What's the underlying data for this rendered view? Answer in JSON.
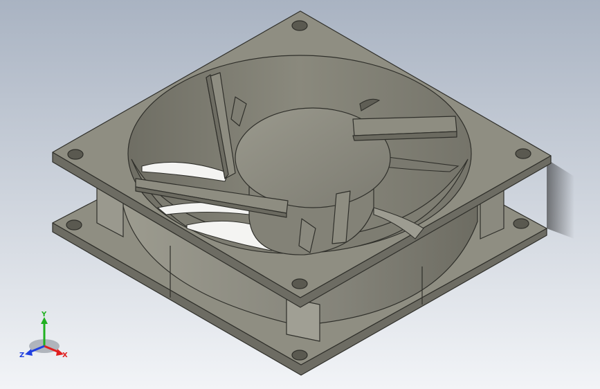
{
  "viewport": {
    "background_top": "#a9b3c2",
    "background_bottom": "#f2f4f7"
  },
  "model": {
    "body_color": "#8f8e82",
    "edge_color": "#2f2f2a",
    "blade_color": "#f4f4f2"
  },
  "triad": {
    "x_label": "X",
    "y_label": "Y",
    "z_label": "Z",
    "x_color": "#e02020",
    "y_color": "#20b020",
    "z_color": "#2040e0"
  }
}
